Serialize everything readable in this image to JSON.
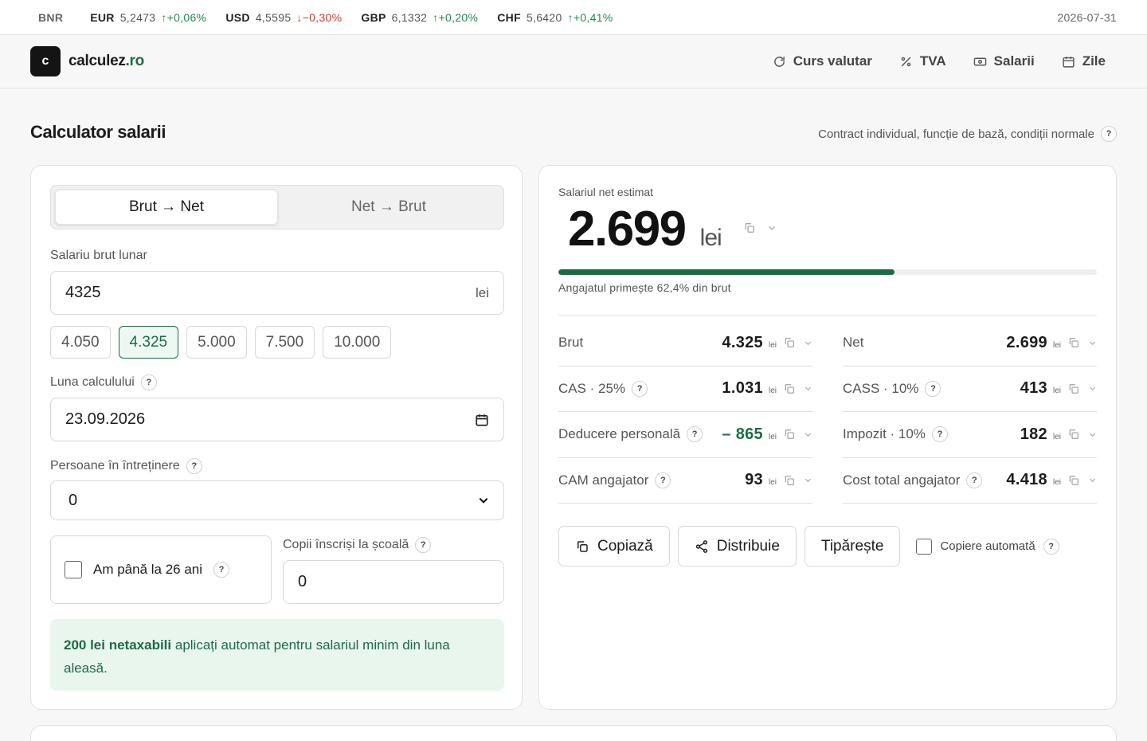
{
  "ticker": {
    "source": "BNR",
    "rates": [
      {
        "code": "EUR",
        "value": "5,2473",
        "change": "↑+0,06%",
        "dir": "up"
      },
      {
        "code": "USD",
        "value": "4,5595",
        "change": "↓−0,30%",
        "dir": "down"
      },
      {
        "code": "GBP",
        "value": "6,1332",
        "change": "↑+0,20%",
        "dir": "up"
      },
      {
        "code": "CHF",
        "value": "5,6420",
        "change": "↑+0,41%",
        "dir": "up"
      }
    ],
    "date": "2026-07-31"
  },
  "header": {
    "logo_letter": "c",
    "logo_name": "calculez",
    "logo_tld": ".ro",
    "nav": [
      {
        "label": "Curs valutar",
        "icon": "refresh-icon"
      },
      {
        "label": "TVA",
        "icon": "percent-icon"
      },
      {
        "label": "Salarii",
        "icon": "banknote-icon"
      },
      {
        "label": "Zile",
        "icon": "calendar-icon"
      }
    ]
  },
  "page": {
    "title": "Calculator salarii",
    "subtitle": "Contract individual, funcție de bază, condiții normale"
  },
  "form": {
    "mode_options": [
      "Brut → Net",
      "Net → Brut"
    ],
    "mode_selected": "Brut → Net",
    "gross_label": "Salariu brut lunar",
    "gross_value": "4325",
    "gross_unit": "lei",
    "presets": [
      "4.050",
      "4.325",
      "5.000",
      "7.500",
      "10.000"
    ],
    "preset_selected": "4.325",
    "month_label": "Luna calculului",
    "month_value": "23.09.2026",
    "dependents_label": "Persoane în întreținere",
    "dependents_value": "0",
    "under26_label": "Am până la 26 ani",
    "under26_checked": false,
    "children_label": "Copii înscriși la școală",
    "children_value": "0",
    "info_bold": "200 lei netaxabili",
    "info_text": " aplicați automat pentru salariul minim din luna aleasă."
  },
  "result": {
    "net_label": "Salariul net estimat",
    "net_value": "2.699",
    "net_unit": "lei",
    "share_ratio": 0.624,
    "share_text": "Angajatul primește 62,4% din brut",
    "rows_left": [
      {
        "label": "Brut",
        "value": "4.325",
        "unit": "lei",
        "help": false,
        "negative": false
      },
      {
        "label": "CAS · 25%",
        "value": "1.031",
        "unit": "lei",
        "help": true,
        "negative": false
      },
      {
        "label": "Deducere personală",
        "value": "– 865",
        "unit": "lei",
        "help": true,
        "negative": true
      },
      {
        "label": "CAM angajator",
        "value": "93",
        "unit": "lei",
        "help": true,
        "negative": false
      }
    ],
    "rows_right": [
      {
        "label": "Net",
        "value": "2.699",
        "unit": "lei",
        "help": false,
        "negative": false
      },
      {
        "label": "CASS · 10%",
        "value": "413",
        "unit": "lei",
        "help": true,
        "negative": false
      },
      {
        "label": "Impozit · 10%",
        "value": "182",
        "unit": "lei",
        "help": true,
        "negative": false
      },
      {
        "label": "Cost total angajator",
        "value": "4.418",
        "unit": "lei",
        "help": true,
        "negative": false
      }
    ],
    "actions": {
      "copy": "Copiază",
      "share": "Distribuie",
      "print": "Tipărește",
      "auto_copy": "Copiere automată"
    }
  },
  "colors": {
    "accent": "#1d6b45",
    "up": "#1f8a52",
    "down": "#d03a2c"
  }
}
